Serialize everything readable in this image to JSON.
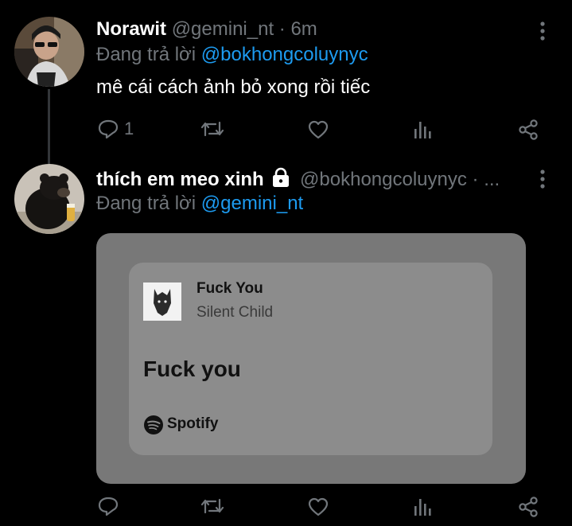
{
  "tweet1": {
    "display_name": "Norawit",
    "handle": "@gemini_nt",
    "time": "· 6m",
    "reply_prefix": "Đang trả lời",
    "reply_to": "@bokhongcoluynyc",
    "text": "mê cái cách ảnh bỏ xong rồi tiếc",
    "reply_count": "1",
    "icons": [
      "reply-icon",
      "retweet-icon",
      "like-icon",
      "views-icon",
      "share-icon",
      "more-icon"
    ]
  },
  "tweet2": {
    "display_name": "thích em meo xinh",
    "handle_and_time": "@bokhongcoluynyc · ...",
    "reply_prefix": "Đang trả lời",
    "reply_to": "@gemini_nt",
    "media": {
      "song_title": "Fuck You",
      "artist": "Silent Child",
      "lyric": "Fuck you",
      "brand": "Spotify"
    },
    "icons": [
      "lock-icon",
      "reply-icon",
      "retweet-icon",
      "like-icon",
      "views-icon",
      "share-icon",
      "more-icon"
    ]
  },
  "colors": {
    "background": "#000000",
    "text_primary": "#ffffff",
    "text_secondary": "#71767b",
    "accent": "#1d9bf0",
    "media_outer": "#787878",
    "media_card": "#8c8c8c"
  }
}
